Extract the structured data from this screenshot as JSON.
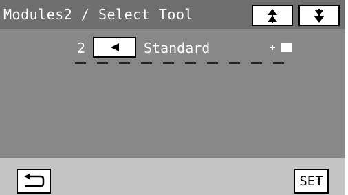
{
  "header": {
    "title": "Modules2 / Select Tool",
    "up_icon": "double-up-arrow-icon",
    "down_icon": "double-down-arrow-icon"
  },
  "tool_row": {
    "number": "2",
    "arrow_icon": "left-triangle-icon",
    "tool_name": "Standard",
    "indicator_icon": "tool-position-marker-icon"
  },
  "footer": {
    "back_icon": "return-arrow-icon",
    "set_label": "SET"
  },
  "colors": {
    "title_bar": "#6f6f6f",
    "content_panel": "#888888",
    "background": "#c4c4c4",
    "button_fill": "#ffffff",
    "text_light": "#ffffff",
    "text_dark": "#000000"
  }
}
